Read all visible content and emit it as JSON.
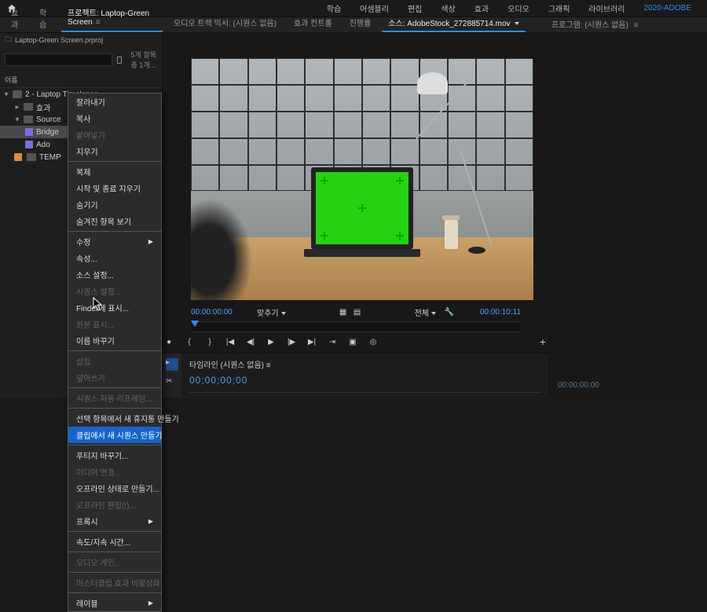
{
  "topbar": {
    "workspaces": [
      "학습",
      "어셈블리",
      "편집",
      "색상",
      "효과",
      "오디오",
      "그래픽",
      "라이브러리"
    ],
    "accent": "2020-ADOBE"
  },
  "tabrow": {
    "left_group": [
      {
        "label": "효과",
        "active": false
      },
      {
        "label": "학습",
        "active": false
      },
      {
        "label": "프로젝트: Laptop-Green Screen",
        "active": true
      }
    ],
    "center_group": [
      {
        "label": "오디오 트랙 믹서: (시퀀스 없음)",
        "active": false
      },
      {
        "label": "효과 컨트롤",
        "active": false
      },
      {
        "label": "진행률",
        "active": false
      },
      {
        "label": "소스: AdobeStock_272885714.mov",
        "active": true
      }
    ],
    "right_group": [
      {
        "label": "프로그램: (시퀀스 없음)",
        "active": false
      }
    ]
  },
  "project": {
    "breadcrumb": "Laptop-Green Screen.prproj",
    "search_placeholder": "",
    "count_label": "5개 항목 중 1개...",
    "column_header": "이름",
    "tree": {
      "root": {
        "label": "2 - Laptop Timelapse"
      },
      "folder1": {
        "label": "효과"
      },
      "folder2": {
        "label": "Source"
      },
      "item_bridge": {
        "label": "Bridge"
      },
      "item_ado": {
        "label": "Ado"
      },
      "folder_temp": {
        "label": "TEMP"
      }
    }
  },
  "context_menu": {
    "g1": [
      "잘라내기",
      "복사",
      "붙여넣기",
      "지우기"
    ],
    "g2": [
      "복제",
      "시작 및 종료 지우기",
      "숨기기",
      "숨겨진 항목 보기"
    ],
    "g3": [
      {
        "label": "수정",
        "sub": true
      },
      {
        "label": "속성...",
        "sub": false
      },
      {
        "label": "소스 설정...",
        "sub": false
      },
      {
        "label": "시퀀스 설정...",
        "sub": false,
        "disabled": true
      },
      {
        "label": "Finder에 표시...",
        "sub": false
      },
      {
        "label": "원본 표시...",
        "sub": false,
        "disabled": true
      },
      {
        "label": "이름 바꾸기",
        "sub": false
      }
    ],
    "g4": [
      {
        "label": "삽입",
        "disabled": true
      },
      {
        "label": "덮어쓰기",
        "disabled": true
      }
    ],
    "g5": [
      {
        "label": "시퀀스 자동 리프레임...",
        "disabled": true
      }
    ],
    "g6": [
      {
        "label": "선택 항목에서 새 휴지통 만들기"
      },
      {
        "label": "클립에서 새 시퀀스 만들기",
        "hover": true
      }
    ],
    "g7": [
      {
        "label": "푸티지 바꾸기...",
        "disabled": false
      },
      {
        "label": "미디어 연결...",
        "disabled": true
      },
      {
        "label": "오프라인 상태로 만들기...",
        "disabled": false
      },
      {
        "label": "오프라인 편집(!)...",
        "disabled": true
      },
      {
        "label": "프록시",
        "sub": true
      }
    ],
    "g8": [
      {
        "label": "속도/지속 시간..."
      }
    ],
    "g9": [
      {
        "label": "오디오 게인...",
        "disabled": true
      }
    ],
    "g10": [
      {
        "label": "마스터클립 효과 비활성화",
        "disabled": true
      }
    ],
    "g11": [
      {
        "label": "레이블",
        "sub": true
      }
    ]
  },
  "source": {
    "tc_in": "00:00:00:00",
    "fit_label": "맞추기",
    "scope_label": "전체",
    "tc_dur": "00:00:10:11"
  },
  "timeline": {
    "title": "타임라인 (시퀀스 없음)",
    "tc": "00;00;00;00"
  },
  "program": {
    "tc": "00:00:00:00"
  }
}
